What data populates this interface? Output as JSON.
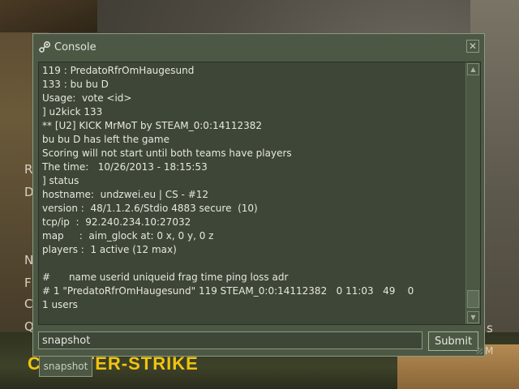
{
  "window": {
    "title": "Console",
    "close_glyph": "✕",
    "icon": "steam-icon"
  },
  "output": {
    "lines": [
      "119 : PredatoRfrOmHaugesund",
      "133 : bu bu D",
      "Usage:  vote <id>",
      "] u2kick 133",
      "** [U2] KICK MrMoT by STEAM_0:0:14112382",
      "bu bu D has left the game",
      "Scoring will not start until both teams have players",
      "The time:   10/26/2013 - 18:15:53",
      "] status",
      "hostname:  undzwei.eu | CS - #12",
      "version :  48/1.1.2.6/Stdio 4883 secure  (10)",
      "tcp/ip  :  92.240.234.10:27032",
      "map     :  aim_glock at: 0 x, 0 y, 0 z",
      "players :  1 active (12 max)",
      "",
      "#      name userid uniqueid frag time ping loss adr",
      "# 1 \"PredatoRfrOmHaugesund\" 119 STEAM_0:0:14112382   0 11:03   49    0",
      "1 users"
    ]
  },
  "command": {
    "value": "snapshot",
    "submit_label": "Submit"
  },
  "background": {
    "autocomplete_hint": "snapshot",
    "logo_text": "COUNTER-STRIKE",
    "menu_letters": [
      "R",
      "D",
      "N",
      "F",
      "C",
      "Q"
    ],
    "right_letters": [
      "s",
      "M"
    ]
  },
  "colors": {
    "panel": "#4c5844",
    "text": "#e6e8e0",
    "logo": "#f1c40f"
  }
}
